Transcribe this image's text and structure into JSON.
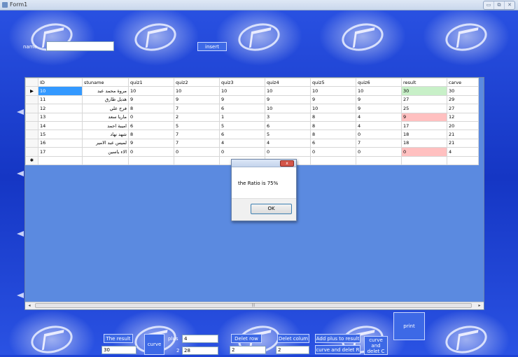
{
  "window": {
    "title": "Form1",
    "min_icon": "minimize-icon",
    "max_icon": "maximize-icon",
    "close_icon": "close-icon"
  },
  "top": {
    "name_label": "name",
    "name_value": "",
    "insert_label": "insert"
  },
  "grid": {
    "columns": [
      "ID",
      "stuname",
      "quiz1",
      "quiz2",
      "quiz3",
      "quiz4",
      "quiz5",
      "quiz6",
      "result",
      "carve"
    ],
    "rows": [
      {
        "marker": "▶",
        "cells": [
          "10",
          "مروة محمد عبد",
          "10",
          "10",
          "10",
          "10",
          "10",
          "10",
          "30",
          "30"
        ]
      },
      {
        "marker": "",
        "cells": [
          "11",
          "هديل طارق",
          "9",
          "9",
          "9",
          "9",
          "9",
          "9",
          "27",
          "29"
        ]
      },
      {
        "marker": "",
        "cells": [
          "12",
          "فرح علي",
          "8",
          "7",
          "6",
          "10",
          "10",
          "9",
          "25",
          "27"
        ]
      },
      {
        "marker": "",
        "cells": [
          "13",
          "ماريا سعد",
          "0",
          "2",
          "1",
          "3",
          "8",
          "4",
          "9",
          "12"
        ]
      },
      {
        "marker": "",
        "cells": [
          "14",
          "اميبة احمد",
          "6",
          "5",
          "5",
          "6",
          "8",
          "4",
          "17",
          "20"
        ]
      },
      {
        "marker": "",
        "cells": [
          "15",
          "شهد نهاد",
          "8",
          "7",
          "6",
          "5",
          "8",
          "0",
          "18",
          "21"
        ]
      },
      {
        "marker": "",
        "cells": [
          "16",
          "لميس عبد الامير",
          "9",
          "7",
          "4",
          "4",
          "6",
          "7",
          "18",
          "21"
        ]
      },
      {
        "marker": "",
        "cells": [
          "17",
          "الاء ياسين",
          "0",
          "0",
          "0",
          "0",
          "0",
          "0",
          "0",
          "4"
        ]
      },
      {
        "marker": "✱",
        "cells": [
          "",
          "",
          "",
          "",
          "",
          "",
          "",
          "",
          "",
          ""
        ]
      }
    ],
    "scroll_thumb": "|||",
    "result_colors": {
      "pass": "#c8f0c8",
      "fail": "#ffc0c0"
    }
  },
  "dialog": {
    "message": "the Ratio is 75%",
    "ok_label": "OK",
    "close_glyph": "x"
  },
  "bottom": {
    "print_label": "print",
    "the_result_label": "The result",
    "the_result_value": "30",
    "curve_label": "curve",
    "plus_label": "plus",
    "plus_value": "4",
    "second_label": "2",
    "second_value": "28",
    "delet_row_label": "Delet row",
    "delet_row_value": "2",
    "delet_colum_label": "Delet colum",
    "delet_colum_value": "2",
    "add_plus_label": "Add plus to result",
    "curve_delet_r_label": "curve and delet R",
    "curve_delet_c_label": "curve and delet C"
  }
}
